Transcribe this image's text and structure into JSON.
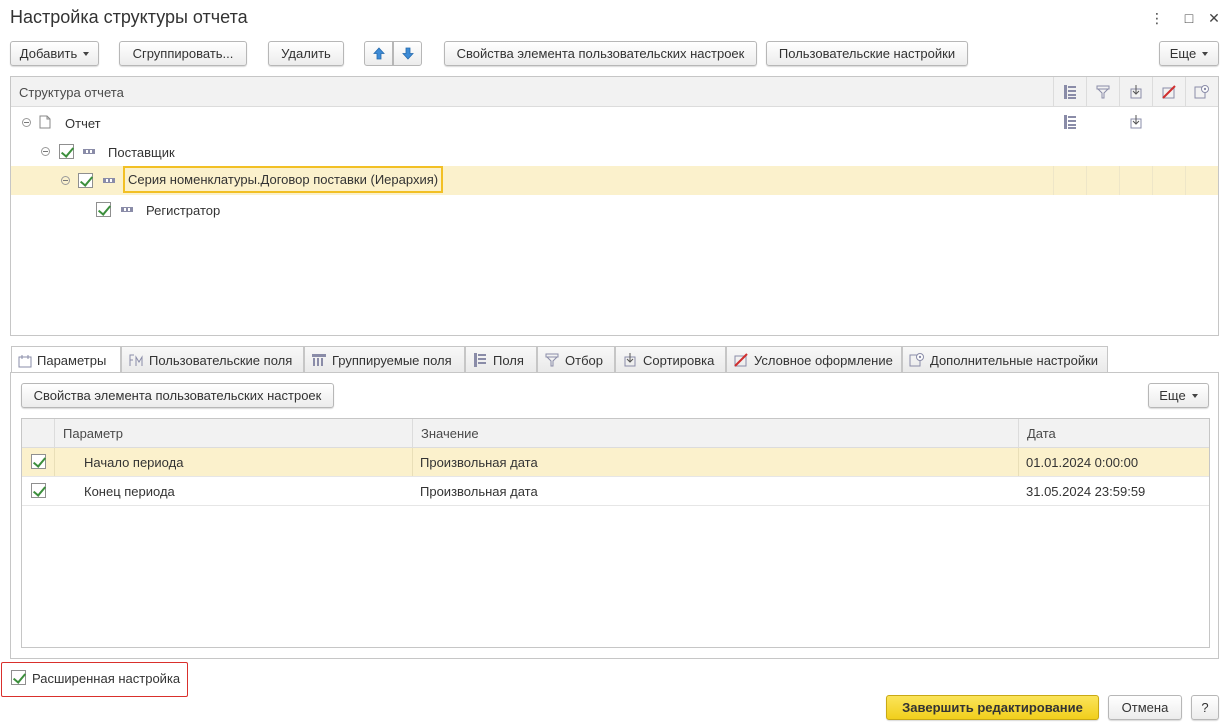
{
  "window": {
    "title": "Настройка структуры отчета",
    "more_icon": "⋮",
    "maximize_icon": "□",
    "close_icon": "✕"
  },
  "toolbar": {
    "add_label": "Добавить",
    "group_label": "Сгруппировать...",
    "delete_label": "Удалить",
    "element_props_label": "Свойства элемента пользовательских настроек",
    "user_settings_label": "Пользовательские настройки",
    "more_label": "Еще"
  },
  "structure": {
    "header": "Структура отчета",
    "nodes": {
      "report": "Отчет",
      "supplier": "Поставщик",
      "series": "Серия номенклатуры.Договор поставки (Иерархия)",
      "registrar": "Регистратор"
    }
  },
  "tabs": [
    {
      "label": "Параметры",
      "icon": "parameters-icon"
    },
    {
      "label": "Пользовательские поля",
      "icon": "user-fields-icon"
    },
    {
      "label": "Группируемые поля",
      "icon": "grouping-fields-icon"
    },
    {
      "label": "Поля",
      "icon": "fields-icon"
    },
    {
      "label": "Отбор",
      "icon": "filter-icon"
    },
    {
      "label": "Сортировка",
      "icon": "sort-icon"
    },
    {
      "label": "Условное оформление",
      "icon": "conditional-format-icon"
    },
    {
      "label": "Дополнительные настройки",
      "icon": "additional-settings-icon"
    }
  ],
  "params_panel": {
    "element_props_label": "Свойства элемента пользовательских настроек",
    "more_label": "Еще",
    "columns": {
      "param": "Параметр",
      "value": "Значение",
      "date": "Дата"
    },
    "rows": [
      {
        "checked": true,
        "param": "Начало периода",
        "value": "Произвольная дата",
        "date": "01.01.2024 0:00:00"
      },
      {
        "checked": true,
        "param": "Конец периода",
        "value": "Произвольная дата",
        "date": "31.05.2024 23:59:59"
      }
    ]
  },
  "footer": {
    "extended_label": "Расширенная настройка",
    "finish_label": "Завершить редактирование",
    "cancel_label": "Отмена",
    "help_label": "?"
  },
  "colors": {
    "accent": "#f5d739",
    "selection": "#fbf1cc",
    "focus_border": "#f2c025",
    "highlight_frame": "#d9302c",
    "check": "#3c8f3c"
  }
}
